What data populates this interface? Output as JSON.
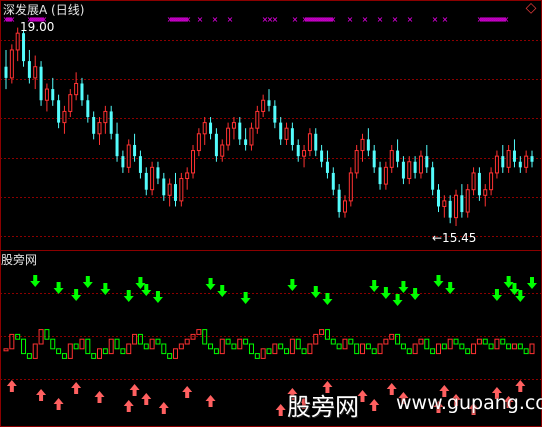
{
  "header": {
    "title": "深发展A (日线)",
    "close_icon": "diamond-close-icon"
  },
  "lower_panel": {
    "title": "股旁网"
  },
  "watermark": {
    "name": "股旁网",
    "url": "www.gupang.com"
  },
  "colors": {
    "up": "#ff3232",
    "down": "#54fcfc",
    "signal_up": "#ff3232",
    "signal_down": "#00ff00",
    "marker": "#ff00ff",
    "grid": "#8b0000"
  },
  "chart_data": [
    {
      "type": "candlestick",
      "title": "深发展A (日线)",
      "annotations": {
        "max_label": "19.00",
        "min_label": "←15.45"
      },
      "price_range": [
        15.2,
        19.1
      ],
      "marker_top_rows": "magenta x markers along top border",
      "candles": [
        [
          18.3,
          18.6,
          17.9,
          18.1
        ],
        [
          18.1,
          18.7,
          18.0,
          18.6
        ],
        [
          18.6,
          19.0,
          18.4,
          18.9
        ],
        [
          18.9,
          18.95,
          18.3,
          18.4
        ],
        [
          18.4,
          18.6,
          18.0,
          18.1
        ],
        [
          18.1,
          18.5,
          17.9,
          18.3
        ],
        [
          18.3,
          18.4,
          17.6,
          17.7
        ],
        [
          17.7,
          18.0,
          17.5,
          17.9
        ],
        [
          17.9,
          18.1,
          17.6,
          17.7
        ],
        [
          17.7,
          17.8,
          17.2,
          17.3
        ],
        [
          17.3,
          17.6,
          17.1,
          17.5
        ],
        [
          17.5,
          17.9,
          17.4,
          17.8
        ],
        [
          17.8,
          18.2,
          17.7,
          18.0
        ],
        [
          18.0,
          18.1,
          17.6,
          17.7
        ],
        [
          17.7,
          17.8,
          17.3,
          17.4
        ],
        [
          17.4,
          17.5,
          17.0,
          17.1
        ],
        [
          17.1,
          17.4,
          16.9,
          17.3
        ],
        [
          17.3,
          17.6,
          17.1,
          17.5
        ],
        [
          17.5,
          17.6,
          17.0,
          17.1
        ],
        [
          17.1,
          17.3,
          16.6,
          16.7
        ],
        [
          16.7,
          16.8,
          16.4,
          16.5
        ],
        [
          16.5,
          17.0,
          16.4,
          16.9
        ],
        [
          16.9,
          17.1,
          16.6,
          16.7
        ],
        [
          16.7,
          16.8,
          16.3,
          16.4
        ],
        [
          16.4,
          16.5,
          16.0,
          16.1
        ],
        [
          16.1,
          16.6,
          16.0,
          16.5
        ],
        [
          16.5,
          16.6,
          16.2,
          16.3
        ],
        [
          16.3,
          16.4,
          15.9,
          16.0
        ],
        [
          16.0,
          16.3,
          15.8,
          16.2
        ],
        [
          16.2,
          16.4,
          15.8,
          15.9
        ],
        [
          15.9,
          16.4,
          15.8,
          16.3
        ],
        [
          16.3,
          16.5,
          16.1,
          16.4
        ],
        [
          16.4,
          16.9,
          16.3,
          16.8
        ],
        [
          16.8,
          17.2,
          16.7,
          17.1
        ],
        [
          17.1,
          17.4,
          16.9,
          17.3
        ],
        [
          17.3,
          17.4,
          17.0,
          17.1
        ],
        [
          17.1,
          17.2,
          16.6,
          16.7
        ],
        [
          16.7,
          17.0,
          16.6,
          16.9
        ],
        [
          16.9,
          17.3,
          16.8,
          17.2
        ],
        [
          17.2,
          17.4,
          17.0,
          17.3
        ],
        [
          17.3,
          17.4,
          16.9,
          17.0
        ],
        [
          17.0,
          17.2,
          16.8,
          16.9
        ],
        [
          16.9,
          17.3,
          16.8,
          17.2
        ],
        [
          17.2,
          17.6,
          17.1,
          17.5
        ],
        [
          17.5,
          17.8,
          17.4,
          17.7
        ],
        [
          17.7,
          17.9,
          17.5,
          17.6
        ],
        [
          17.6,
          17.7,
          17.2,
          17.3
        ],
        [
          17.3,
          17.4,
          16.9,
          17.0
        ],
        [
          17.0,
          17.3,
          16.9,
          17.2
        ],
        [
          17.2,
          17.3,
          16.8,
          16.9
        ],
        [
          16.9,
          17.0,
          16.6,
          16.7
        ],
        [
          16.7,
          16.9,
          16.5,
          16.8
        ],
        [
          16.8,
          17.2,
          16.7,
          17.1
        ],
        [
          17.1,
          17.2,
          16.7,
          16.8
        ],
        [
          16.8,
          16.9,
          16.5,
          16.6
        ],
        [
          16.6,
          16.8,
          16.3,
          16.4
        ],
        [
          16.4,
          16.5,
          16.0,
          16.1
        ],
        [
          16.1,
          16.2,
          15.6,
          15.7
        ],
        [
          15.7,
          16.0,
          15.6,
          15.9
        ],
        [
          15.9,
          16.5,
          15.8,
          16.4
        ],
        [
          16.4,
          16.9,
          16.3,
          16.8
        ],
        [
          16.8,
          17.1,
          16.6,
          17.0
        ],
        [
          17.0,
          17.2,
          16.7,
          16.8
        ],
        [
          16.8,
          16.9,
          16.4,
          16.5
        ],
        [
          16.5,
          16.6,
          16.1,
          16.2
        ],
        [
          16.2,
          16.6,
          16.1,
          16.5
        ],
        [
          16.5,
          16.9,
          16.4,
          16.8
        ],
        [
          16.8,
          17.0,
          16.5,
          16.6
        ],
        [
          16.6,
          16.7,
          16.2,
          16.3
        ],
        [
          16.3,
          16.7,
          16.2,
          16.6
        ],
        [
          16.6,
          16.7,
          16.3,
          16.4
        ],
        [
          16.4,
          16.8,
          16.3,
          16.7
        ],
        [
          16.7,
          16.9,
          16.4,
          16.5
        ],
        [
          16.5,
          16.6,
          16.0,
          16.1
        ],
        [
          16.1,
          16.2,
          15.7,
          15.8
        ],
        [
          15.8,
          16.0,
          15.6,
          15.9
        ],
        [
          15.9,
          16.0,
          15.5,
          15.6
        ],
        [
          15.6,
          16.1,
          15.45,
          16.0
        ],
        [
          16.0,
          16.2,
          15.6,
          15.7
        ],
        [
          15.7,
          16.2,
          15.6,
          16.1
        ],
        [
          16.1,
          16.5,
          16.0,
          16.4
        ],
        [
          16.4,
          16.5,
          15.9,
          16.0
        ],
        [
          16.0,
          16.2,
          15.8,
          16.1
        ],
        [
          16.1,
          16.5,
          16.0,
          16.4
        ],
        [
          16.4,
          16.8,
          16.3,
          16.7
        ],
        [
          16.7,
          16.9,
          16.4,
          16.5
        ],
        [
          16.5,
          16.9,
          16.4,
          16.8
        ],
        [
          16.8,
          17.0,
          16.5,
          16.6
        ],
        [
          16.6,
          16.7,
          16.4,
          16.5
        ],
        [
          16.5,
          16.8,
          16.4,
          16.7
        ],
        [
          16.7,
          16.8,
          16.5,
          16.6
        ]
      ]
    },
    {
      "type": "indicator",
      "title": "股旁网",
      "down_arrow_signals": [
        5,
        9,
        12,
        14,
        17,
        21,
        23,
        24,
        26,
        35,
        37,
        41,
        49,
        53,
        55,
        63,
        65,
        67,
        68,
        70,
        74,
        76,
        84,
        86,
        87,
        88,
        90
      ],
      "up_arrow_signals": [
        1,
        6,
        9,
        12,
        16,
        21,
        22,
        24,
        27,
        31,
        35,
        47,
        49,
        51,
        55,
        61,
        63,
        66,
        68,
        74,
        75,
        77,
        80,
        84,
        86,
        88
      ],
      "bars": [
        0.4,
        0.7,
        0.6,
        0.3,
        0.2,
        0.5,
        0.8,
        0.6,
        0.4,
        0.3,
        0.2,
        0.5,
        0.4,
        0.6,
        0.3,
        0.2,
        0.4,
        0.3,
        0.6,
        0.4,
        0.3,
        0.5,
        0.7,
        0.5,
        0.4,
        0.6,
        0.5,
        0.3,
        0.2,
        0.4,
        0.5,
        0.6,
        0.7,
        0.8,
        0.5,
        0.4,
        0.3,
        0.6,
        0.5,
        0.4,
        0.6,
        0.5,
        0.3,
        0.2,
        0.4,
        0.3,
        0.5,
        0.4,
        0.3,
        0.6,
        0.4,
        0.3,
        0.5,
        0.7,
        0.8,
        0.6,
        0.5,
        0.4,
        0.6,
        0.5,
        0.3,
        0.5,
        0.4,
        0.3,
        0.5,
        0.6,
        0.7,
        0.5,
        0.4,
        0.3,
        0.5,
        0.6,
        0.4,
        0.3,
        0.5,
        0.4,
        0.6,
        0.5,
        0.4,
        0.3,
        0.5,
        0.6,
        0.5,
        0.4,
        0.6,
        0.5,
        0.4,
        0.5,
        0.4,
        0.3,
        0.5
      ]
    }
  ]
}
